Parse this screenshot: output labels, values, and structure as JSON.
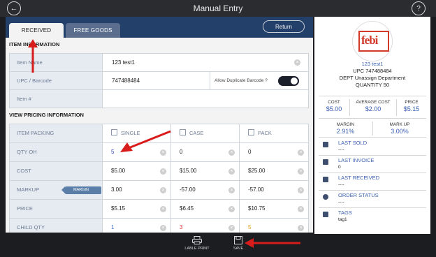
{
  "header": {
    "title": "Manual Entry",
    "back_icon": "back-arrow-icon",
    "help_label": "?"
  },
  "tabs": [
    {
      "label": "RECEIVED",
      "active": true
    },
    {
      "label": "FREE GOODS",
      "active": false
    }
  ],
  "return_label": "Return",
  "item_info": {
    "title": "ITEM INFORMATION",
    "fields": [
      {
        "label": "Item Name",
        "value": "123 test1"
      },
      {
        "label": "UPC / Barcode",
        "value": "747488484",
        "dup_label": "Allow Duplicate Barcode ?",
        "dup_on": true
      },
      {
        "label": "Item #",
        "value": ""
      }
    ]
  },
  "pricing": {
    "title": "VIEW PRICING INFORMATION",
    "head_label": "ITEM PACKING",
    "columns": [
      "SINGLE",
      "CASE",
      "PACK"
    ],
    "margin_tag": "MARGIN",
    "rows": [
      {
        "label": "QTY OH",
        "values": [
          "5",
          "0",
          "0"
        ],
        "colors": [
          "#2a3fc0",
          "#222222",
          "#222222"
        ]
      },
      {
        "label": "COST",
        "values": [
          "$5.00",
          "$15.00",
          "$25.00"
        ],
        "colors": [
          "#222222",
          "#222222",
          "#222222"
        ]
      },
      {
        "label": "MARKUP",
        "values": [
          "3.00",
          "-57.00",
          "-57.00"
        ],
        "colors": [
          "#222222",
          "#222222",
          "#222222"
        ]
      },
      {
        "label": "PRICE",
        "values": [
          "$5.15",
          "$6.45",
          "$10.75"
        ],
        "colors": [
          "#222222",
          "#222222",
          "#222222"
        ]
      },
      {
        "label": "CHILD QTY",
        "values": [
          "1",
          "3",
          "5"
        ],
        "colors": [
          "#3a6fd0",
          "#e0303a",
          "#e8a020"
        ]
      }
    ]
  },
  "side": {
    "logo_text": "febi",
    "name": "123 test1",
    "upc": "UPC 747488484",
    "dept": "DEPT Unassign Department",
    "qty": "QUANTITY 50",
    "stats1": [
      {
        "k": "COST",
        "v": "$5.00"
      },
      {
        "k": "AVERAGE COST",
        "v": "$2.00"
      },
      {
        "k": "PRICE",
        "v": "$5.15"
      }
    ],
    "stats2": [
      {
        "k": "MARGIN",
        "v": "2.91%"
      },
      {
        "k": "MARK UP",
        "v": "3.00%"
      }
    ],
    "info": [
      {
        "k": "LAST SOLD",
        "v": "----",
        "icon": "shopping-bag-icon"
      },
      {
        "k": "LAST INVOICE",
        "v": "0",
        "icon": "layers-icon"
      },
      {
        "k": "LAST RECEIVED",
        "v": "----",
        "icon": "inbox-icon"
      },
      {
        "k": "ORDER STATUS",
        "v": "----",
        "icon": "pie-icon"
      },
      {
        "k": "TAGS",
        "v": "tag1",
        "icon": "tag-icon"
      }
    ]
  },
  "footer": {
    "print_label": "LABLE PRINT",
    "save_label": "SAVE"
  },
  "colors": {
    "accent": "#22406a",
    "link": "#3a5fb0",
    "arrow": "#d81b1b"
  }
}
